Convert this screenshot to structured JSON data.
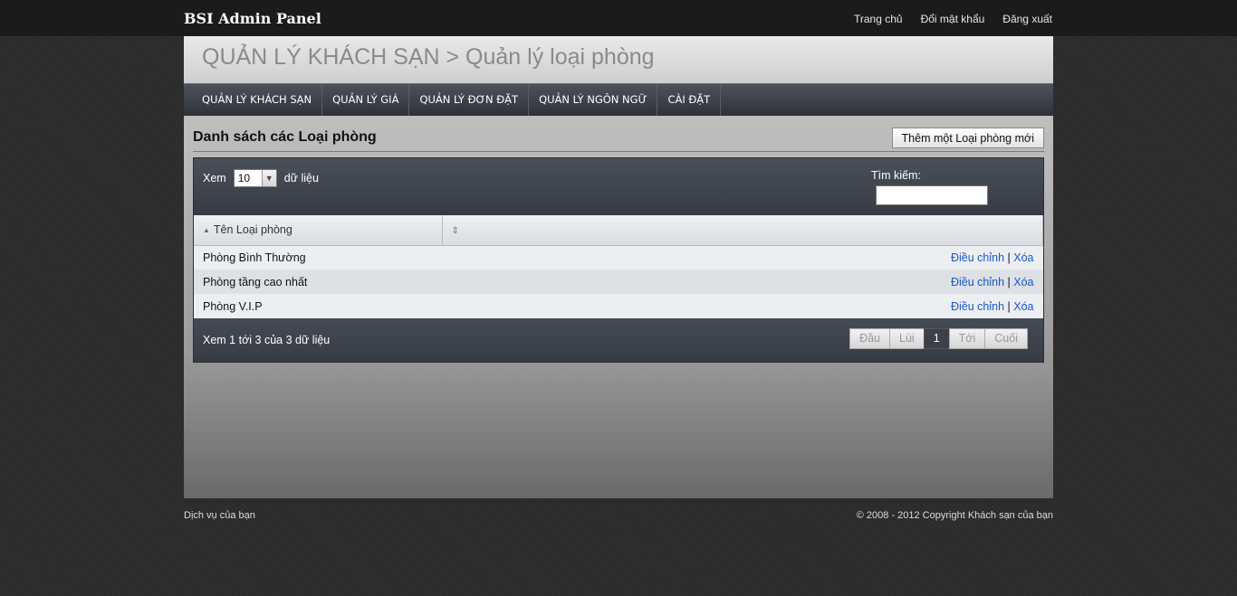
{
  "topbar": {
    "brand": "BSI Admin Panel",
    "links": [
      "Trang chủ",
      "Đổi mật khẩu",
      "Đăng xuất"
    ]
  },
  "header": {
    "title": "QUẢN LÝ KHÁCH SẠN > Quản lý loại phòng"
  },
  "nav": [
    "QUẢN LÝ KHÁCH SẠN",
    "QUẢN LÝ GIÁ",
    "QUẢN LÝ ĐƠN ĐẶT",
    "QUẢN LÝ NGÔN NGỮ",
    "CÀI ĐẶT"
  ],
  "section": {
    "title": "Danh sách các Loại phòng",
    "add_button": "Thêm một Loại phòng mới"
  },
  "table": {
    "length_label_before": "Xem",
    "length_value": "10",
    "length_label_after": "dữ liệu",
    "search_label": "Tìm kiếm:",
    "search_value": "",
    "columns": [
      "Tên Loại phòng",
      ""
    ],
    "rows": [
      {
        "name": "Phòng Bình Thường",
        "edit": "Điều chỉnh",
        "sep": "|",
        "delete": "Xóa"
      },
      {
        "name": "Phòng tầng cao nhất",
        "edit": "Điều chỉnh",
        "sep": "|",
        "delete": "Xóa"
      },
      {
        "name": "Phòng V.I.P",
        "edit": "Điều chỉnh",
        "sep": "|",
        "delete": "Xóa"
      }
    ],
    "info": "Xem 1 tới 3 của 3 dữ liệu",
    "pager": {
      "first": "Đầu",
      "prev": "Lùi",
      "current": "1",
      "next": "Tới",
      "last": "Cuối"
    }
  },
  "footer": {
    "left": "Dịch vụ của bạn",
    "right": "© 2008 - 2012 Copyright Khách sạn của bạn"
  }
}
